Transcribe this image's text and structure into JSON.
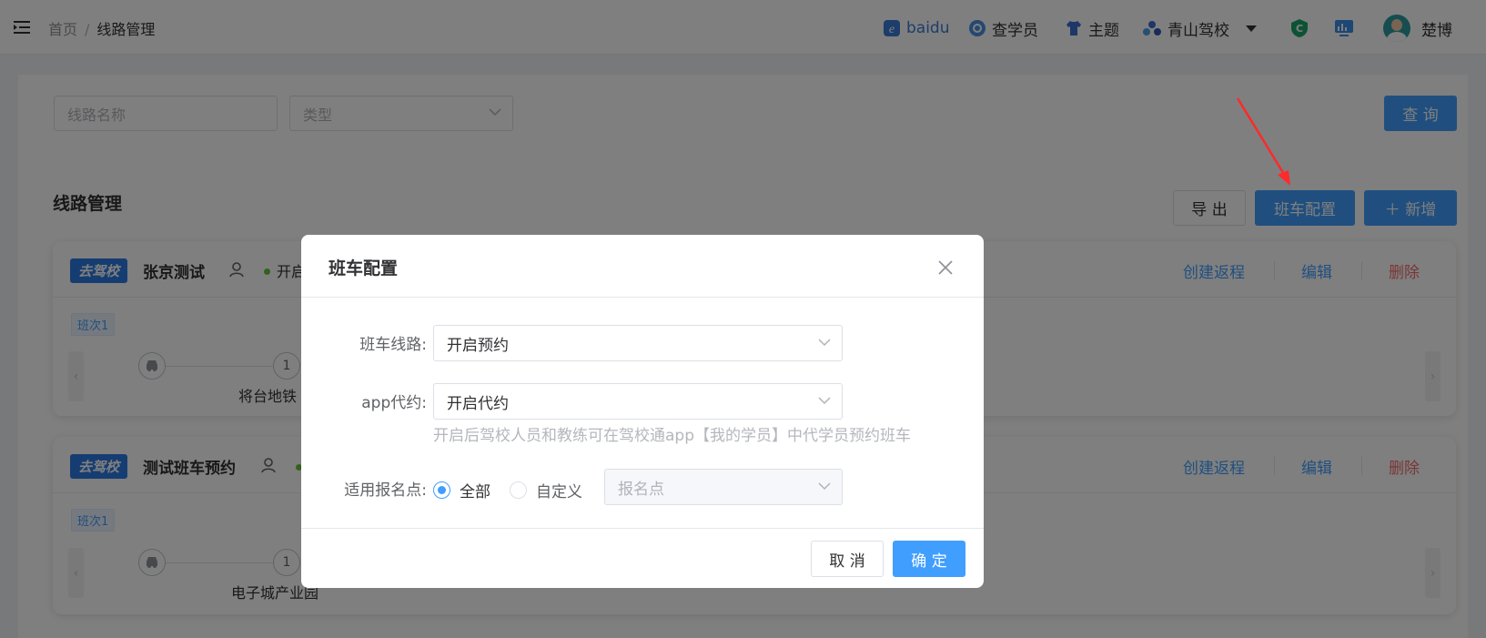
{
  "header": {
    "breadcrumb": [
      "首页",
      "线路管理"
    ],
    "breadcrumb_sep": "/",
    "items": {
      "baidu": "baidu",
      "search_student": "查学员",
      "theme": "主题",
      "school": "青山驾校",
      "user": "楚博"
    }
  },
  "filters": {
    "route_name_placeholder": "线路名称",
    "type_placeholder": "类型",
    "query_label": "查 询"
  },
  "section": {
    "title": "线路管理",
    "export_label": "导 出",
    "shuttle_config_label": "班车配置",
    "add_label": "＋ 新增"
  },
  "routes": [
    {
      "logo": "去驾校",
      "name": "张京测试",
      "status": "开启",
      "shift": "班次1",
      "stop_number": "1",
      "stop_label": "将台地铁",
      "actions": [
        "创建返程",
        "编辑",
        "删除"
      ]
    },
    {
      "logo": "去驾校",
      "name": "测试班车预约",
      "status": "",
      "shift": "班次1",
      "stop_number": "1",
      "stop_label": "电子城产业园",
      "actions": [
        "创建返程",
        "编辑",
        "删除"
      ]
    }
  ],
  "dialog": {
    "title": "班车配置",
    "fields": {
      "shuttle_route_label": "班车线路:",
      "shuttle_route_value": "开启预约",
      "app_proxy_label": "app代约:",
      "app_proxy_value": "开启代约",
      "app_proxy_hint": "开启后驾校人员和教练可在驾校通app【我的学员】中代学员预约班车",
      "signup_point_label": "适用报名点:",
      "radio_all": "全部",
      "radio_custom": "自定义",
      "signup_point_placeholder": "报名点"
    },
    "selected_radio": "全部",
    "cancel_label": "取 消",
    "ok_label": "确 定"
  },
  "colors": {
    "primary": "#409eff",
    "danger": "#f56c6c",
    "annotation_arrow": "#ff2a2a",
    "logo_blue": "#2d7be5"
  }
}
